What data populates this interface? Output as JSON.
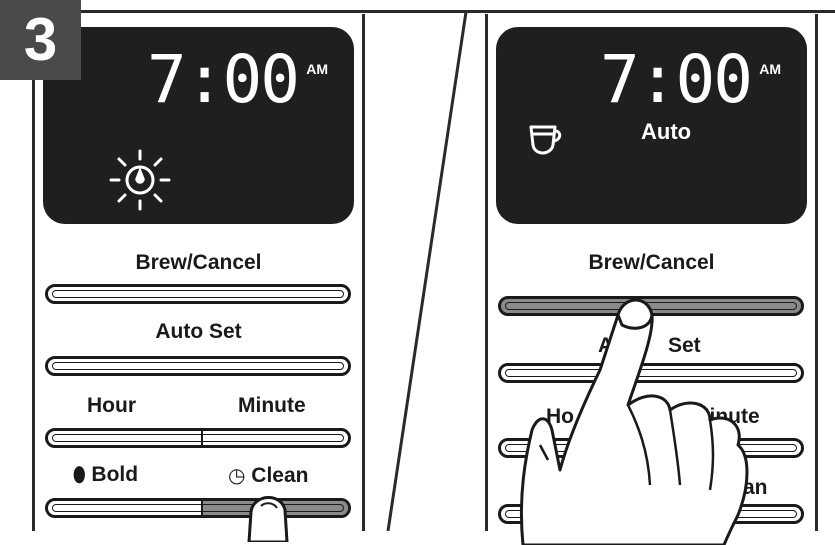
{
  "step": {
    "number": "3"
  },
  "left_panel": {
    "display": {
      "time": "7:00",
      "meridiem": "AM",
      "status_icon": "sun-clock-brewing-icon"
    },
    "buttons": {
      "brew_cancel": "Brew/Cancel",
      "auto_set": "Auto Set",
      "hour": "Hour",
      "minute": "Minute",
      "bold": "Bold",
      "clean": "Clean"
    },
    "pressed_button": "Clean"
  },
  "right_panel": {
    "display": {
      "time": "7:00",
      "meridiem": "AM",
      "mode": "Auto",
      "status_icon": "coffee-cup-icon"
    },
    "buttons": {
      "brew_cancel": "Brew/Cancel",
      "auto_set_partial_left": "A",
      "auto_set_partial_right": "Set",
      "hour_partial": "Ho",
      "minute_partial": "Minute",
      "clean_partial": "an"
    },
    "pressed_button": "Brew/Cancel"
  },
  "colors": {
    "lcd": "#1f1f1f",
    "badge": "#4a4a4a",
    "pressed": "#8a8a8a",
    "line": "#1a1a1a"
  }
}
